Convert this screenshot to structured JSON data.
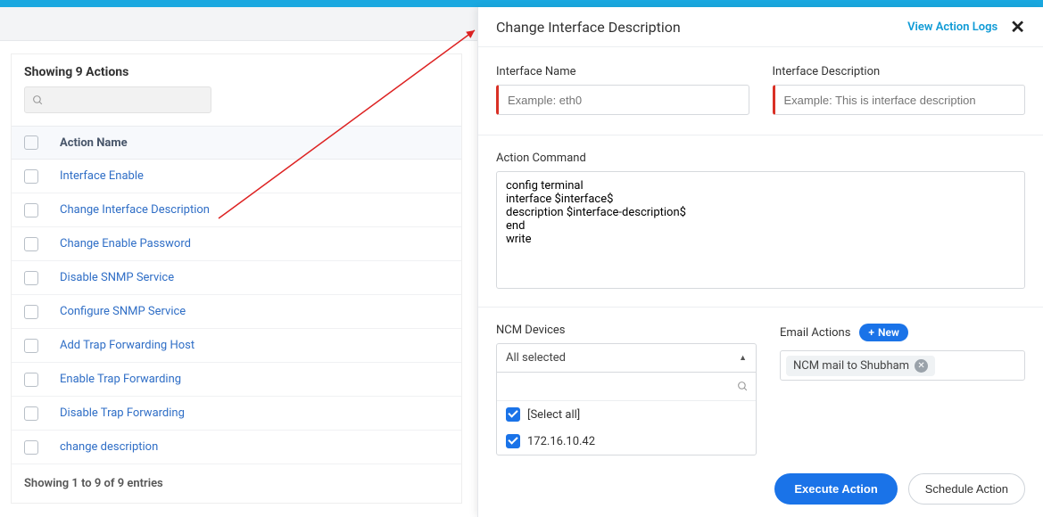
{
  "left": {
    "title": "Showing 9 Actions",
    "column_header": "Action Name",
    "actions": [
      "Interface Enable",
      "Change Interface Description",
      "Change Enable Password",
      "Disable SNMP Service",
      "Configure SNMP Service",
      "Add Trap Forwarding Host",
      "Enable Trap Forwarding",
      "Disable Trap Forwarding",
      "change description"
    ],
    "footer": "Showing 1 to 9 of 9 entries"
  },
  "right": {
    "title": "Change Interface Description",
    "view_logs": "View Action Logs",
    "interface_name_label": "Interface Name",
    "interface_name_placeholder": "Example: eth0",
    "interface_desc_label": "Interface Description",
    "interface_desc_placeholder": "Example: This is interface description",
    "action_command_label": "Action Command",
    "action_command_value": "config terminal\ninterface $interface$\ndescription $interface-description$\nend\nwrite",
    "ncm_label": "NCM Devices",
    "ncm_selected": "All selected",
    "ncm_options": {
      "select_all": "[Select all]",
      "opt1": "172.16.10.42"
    },
    "email_label": "Email Actions",
    "new_label": "New",
    "chip_text": "NCM mail to Shubham",
    "execute": "Execute Action",
    "schedule": "Schedule Action"
  }
}
